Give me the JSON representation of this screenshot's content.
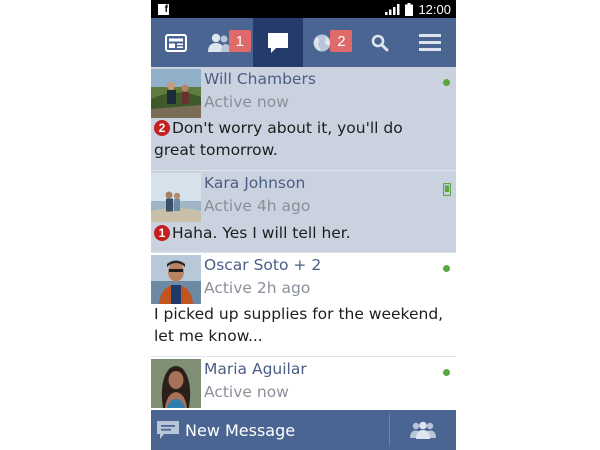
{
  "statusbar": {
    "app": "f",
    "time": "12:00"
  },
  "nav": {
    "tabs": [
      {
        "icon": "news-feed-icon"
      },
      {
        "icon": "friend-requests-icon",
        "badge": "1"
      },
      {
        "icon": "messages-icon"
      },
      {
        "icon": "notifications-globe-icon",
        "badge": "2"
      },
      {
        "icon": "search-icon"
      },
      {
        "icon": "menu-icon"
      }
    ]
  },
  "conversations": [
    {
      "name": "Will Chambers",
      "status": "Active now",
      "unread_count": "2",
      "message": "Don't worry about it, you'll do great tomorrow.",
      "presence": "online-dot"
    },
    {
      "name": "Kara Johnson",
      "status": "Active 4h ago",
      "unread_count": "1",
      "message": "Haha. Yes I will tell her.",
      "presence": "mobile-icon"
    },
    {
      "name": "Oscar Soto + 2",
      "status": "Active 2h ago",
      "message": "I picked up supplies for the weekend, let me know...",
      "presence": "online-dot"
    },
    {
      "name": "Maria Aguilar",
      "status": "Active now",
      "presence": "online-dot"
    }
  ],
  "bottombar": {
    "new_message_label": "New Message"
  },
  "colors": {
    "navbar": "#4b6593",
    "navbar_active": "#253c6b",
    "unread_row": "#cad2df",
    "name_text": "#4b5e85",
    "online": "#5aa73f",
    "unread_badge": "#c51f1f",
    "nav_badge": "#e06a6a"
  }
}
